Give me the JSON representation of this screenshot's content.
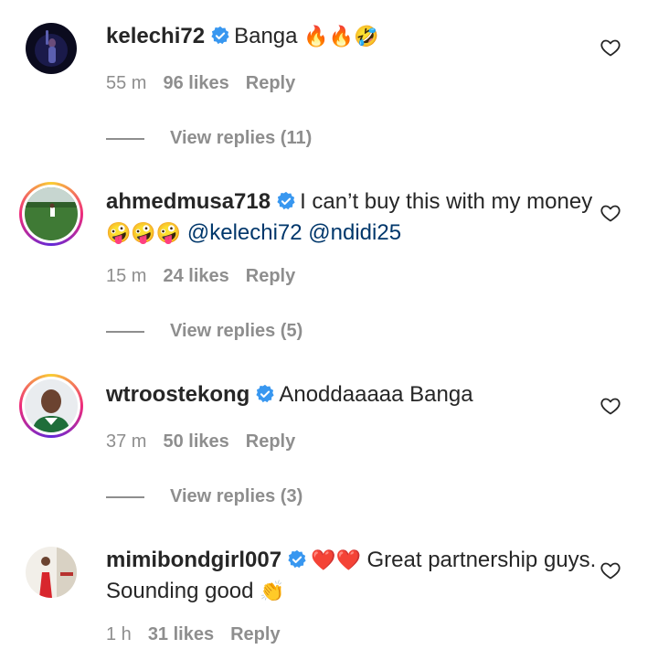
{
  "comments": [
    {
      "username": "kelechi72",
      "text": "Banga",
      "emojis": "🔥🔥🤣",
      "mentions": "",
      "time": "55 m",
      "likes": "96 likes",
      "reply": "Reply",
      "view_replies": "View replies (11)",
      "story_ring": false
    },
    {
      "username": "ahmedmusa718",
      "text": "I can’t buy this with my money",
      "emojis": "🤪🤪🤪",
      "mentions": "@kelechi72 @ndidi25",
      "time": "15 m",
      "likes": "24 likes",
      "reply": "Reply",
      "view_replies": "View replies (5)",
      "story_ring": true
    },
    {
      "username": "wtroostekong",
      "text": "Anoddaaaaa Banga",
      "emojis": "",
      "mentions": "",
      "time": "37 m",
      "likes": "50 likes",
      "reply": "Reply",
      "view_replies": "View replies (3)",
      "story_ring": true
    },
    {
      "username": "mimibondgirl007",
      "pre_emojis": "❤️❤️",
      "text": "Great partnership guys. Sounding good",
      "emojis": "👏",
      "mentions": "",
      "time": "1 h",
      "likes": "31 likes",
      "reply": "Reply",
      "story_ring": false
    }
  ],
  "colors": {
    "text": "#262626",
    "secondary": "#8e8e8e",
    "mention": "#00376b",
    "verified": "#3897f0"
  },
  "icons": {
    "verified": "verified-badge-icon",
    "like": "heart-outline-icon"
  }
}
